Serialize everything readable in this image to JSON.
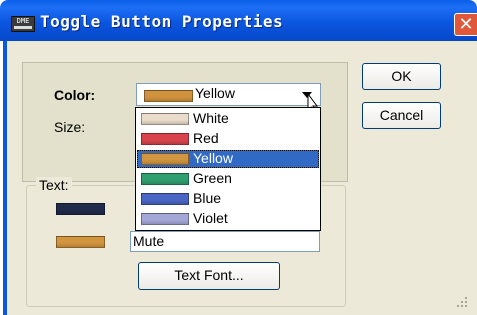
{
  "window": {
    "title": "Toggle Button Properties",
    "icon_text": "DME",
    "close_glyph": "✕"
  },
  "form": {
    "color_label": "Color:",
    "size_label": "Size:",
    "text_group_label": "Text:",
    "combo": {
      "selected_label": "Yellow",
      "selected_color": "#d1923e"
    },
    "text_value": "Mute",
    "text_font_button": "Text Font..."
  },
  "options": [
    {
      "label": "White",
      "color": "#e9dccb",
      "selected": false
    },
    {
      "label": "Red",
      "color": "#d9434c",
      "selected": false
    },
    {
      "label": "Yellow",
      "color": "#d29540",
      "selected": true
    },
    {
      "label": "Green",
      "color": "#2f9f6f",
      "selected": false
    },
    {
      "label": "Blue",
      "color": "#4a66c4",
      "selected": false
    },
    {
      "label": "Violet",
      "color": "#a3a8d8",
      "selected": false
    }
  ],
  "text_colors": {
    "background": "#202a4a",
    "foreground": "#d29540"
  },
  "buttons": {
    "ok": "OK",
    "cancel": "Cancel"
  }
}
